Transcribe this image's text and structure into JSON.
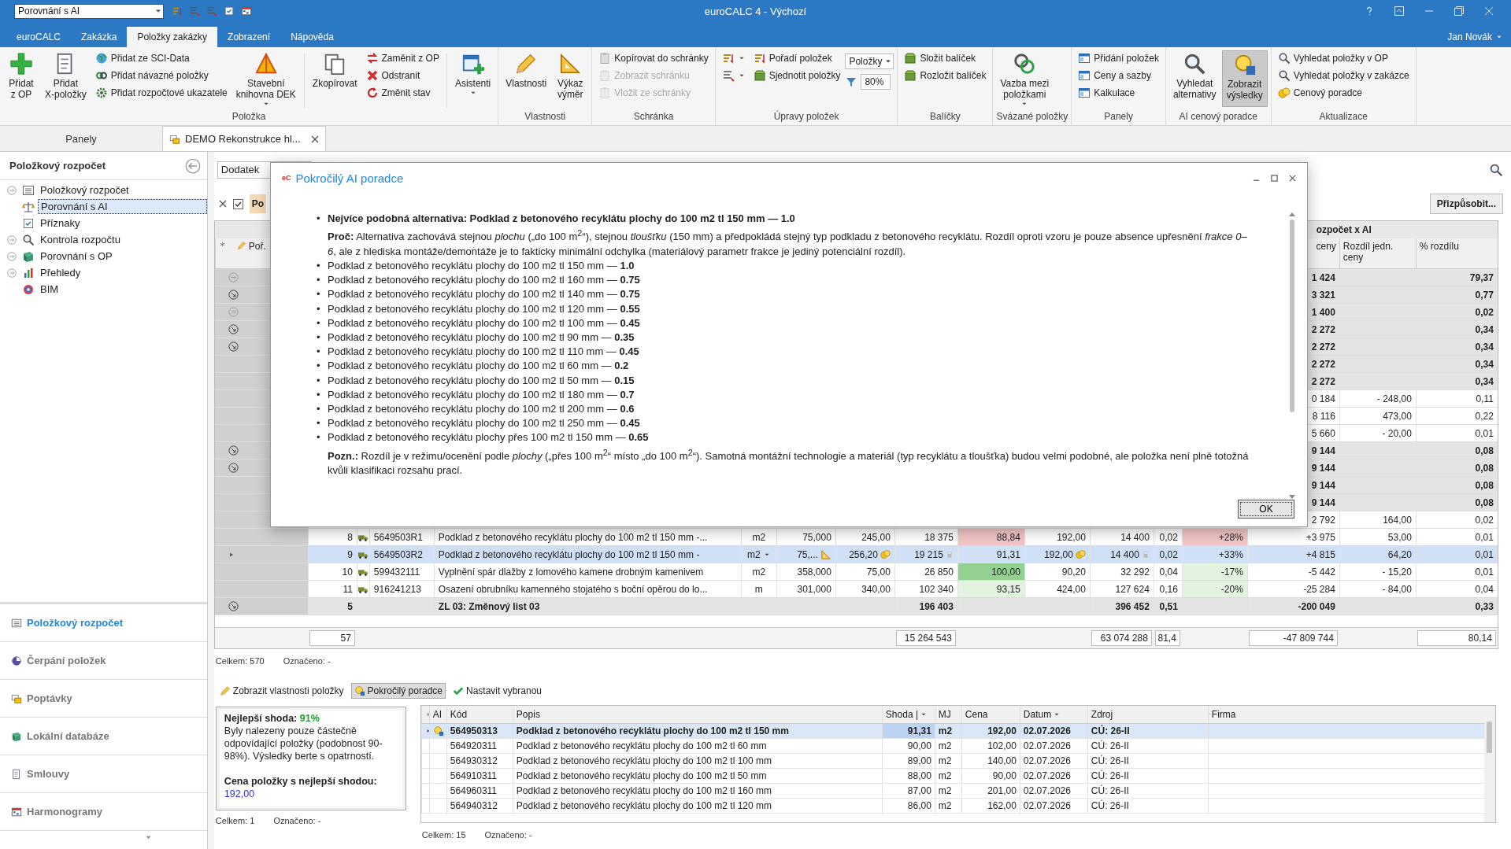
{
  "titlebar": {
    "quick_combo": "Porovnání s AI",
    "title": "euroCALC 4 - Výchozí"
  },
  "menu": {
    "tabs": [
      {
        "label": "euroCALC",
        "selected": false
      },
      {
        "label": "Zakázka",
        "selected": false
      },
      {
        "label": "Položky zakázky",
        "selected": true
      },
      {
        "label": "Zobrazení",
        "selected": false
      },
      {
        "label": "Nápověda",
        "selected": false
      }
    ],
    "user": "Jan Novák"
  },
  "ribbon": {
    "groups": [
      {
        "label": "Položka",
        "buttons": [
          {
            "kind": "large",
            "label": "Přidat\nz OP"
          },
          {
            "kind": "large",
            "label": "Přidat\nX-položky"
          },
          {
            "kind": "stack",
            "items": [
              {
                "label": "Přidat ze SCI-Data"
              },
              {
                "label": "Přidat návazné položky"
              },
              {
                "label": "Přidat rozpočtové ukazatele"
              }
            ]
          },
          {
            "kind": "large",
            "label": "Stavební\nknihovna DEK",
            "dropdown": true
          },
          {
            "kind": "separator"
          },
          {
            "kind": "large",
            "label": "Zkopírovat"
          },
          {
            "kind": "stack",
            "items": [
              {
                "label": "Zaměnit z OP"
              },
              {
                "label": "Odstranit"
              },
              {
                "label": "Změnit stav"
              }
            ]
          },
          {
            "kind": "separator"
          },
          {
            "kind": "large",
            "label": "Asistenti",
            "dropdown": true
          }
        ]
      },
      {
        "label": "Vlastnosti",
        "buttons": [
          {
            "kind": "large",
            "label": "Vlastnosti"
          },
          {
            "kind": "large",
            "label": "Výkaz\nvýměr"
          }
        ]
      },
      {
        "label": "Schránka",
        "buttons": [
          {
            "kind": "stack",
            "items": [
              {
                "label": "Kopírovat do schránky",
                "disabled": false
              },
              {
                "label": "Zobrazit schránku",
                "disabled": true
              },
              {
                "label": "Vložit ze schránky",
                "disabled": true
              }
            ]
          }
        ]
      },
      {
        "label": "Úpravy položek",
        "buttons": [
          {
            "kind": "icon-stack"
          },
          {
            "kind": "stack",
            "items": [
              {
                "label": "Pořadí položek"
              },
              {
                "label": "Sjednotit položky"
              }
            ]
          },
          {
            "kind": "editors",
            "combo": "Položky",
            "spin": "80%"
          }
        ]
      },
      {
        "label": "Balíčky",
        "buttons": [
          {
            "kind": "stack",
            "items": [
              {
                "label": "Složit balíček"
              },
              {
                "label": "Rozložit balíček"
              }
            ]
          }
        ]
      },
      {
        "label": "Svázané položky",
        "buttons": [
          {
            "kind": "large",
            "label": "Vazba mezi\npoložkami",
            "dropdown": true
          }
        ]
      },
      {
        "label": "Panely",
        "buttons": [
          {
            "kind": "stack",
            "items": [
              {
                "label": "Přidání položek"
              },
              {
                "label": "Ceny a sazby"
              },
              {
                "label": "Kalkulace"
              }
            ]
          }
        ]
      },
      {
        "label": "AI cenový poradce",
        "buttons": [
          {
            "kind": "large",
            "label": "Vyhledat\nalternativy",
            "pressed": false
          },
          {
            "kind": "large",
            "label": "Zobrazit\nvýsledky",
            "pressed": true
          }
        ]
      },
      {
        "label": "Aktualizace",
        "buttons": [
          {
            "kind": "stack",
            "items": [
              {
                "label": "Vyhledat položky v OP"
              },
              {
                "label": "Vyhledat položky v zakázce"
              },
              {
                "label": "Cenový poradce"
              }
            ]
          }
        ]
      }
    ]
  },
  "panels_header": "Panely",
  "document_tab": "DEMO Rekonstrukce hl...",
  "sidebar": {
    "title": "Položkový rozpočet",
    "tree": [
      {
        "label": "Položkový rozpočet",
        "kind": "branch",
        "selected": false
      },
      {
        "label": "Porovnání s AI",
        "kind": "leaf",
        "selected": true
      },
      {
        "label": "Příznaky",
        "kind": "leaf",
        "selected": false
      },
      {
        "label": "Kontrola rozpočtu",
        "kind": "branch",
        "selected": false
      },
      {
        "label": "Porovnání s OP",
        "kind": "branch",
        "selected": false
      },
      {
        "label": "Přehledy",
        "kind": "branch",
        "selected": false
      },
      {
        "label": "BIM",
        "kind": "leaf",
        "selected": false
      }
    ],
    "nav": [
      {
        "label": "Položkový rozpočet",
        "selected": true
      },
      {
        "label": "Čerpání položek",
        "selected": false
      },
      {
        "label": "Poptávky",
        "selected": false
      },
      {
        "label": "Lokální databáze",
        "selected": false
      },
      {
        "label": "Smlouvy",
        "selected": false
      },
      {
        "label": "Harmonogramy",
        "selected": false
      }
    ]
  },
  "toolbar": {
    "filter": "Dodatek",
    "show_all_checked": true,
    "tab_fragment": "Po",
    "customize_button": "Přizpůsobit..."
  },
  "table": {
    "group_header": "ozpočet x AI",
    "columns": {
      "por": "Poř.",
      "c6": "ceny",
      "c7": "Rozdíl jedn. ceny",
      "c8": "% rozdílu"
    },
    "rows": [
      {
        "kind": "group",
        "expanded": false,
        "selected": false,
        "c6": "1 424",
        "c8": "79,37"
      },
      {
        "kind": "group",
        "expanded": true,
        "selected": false,
        "c6": "3 321",
        "c8": "0,77"
      },
      {
        "kind": "group",
        "expanded": false,
        "selected": false,
        "c6": "1 400",
        "c8": "0,02"
      },
      {
        "kind": "group",
        "expanded": true,
        "selected": false,
        "c6": "2 272",
        "c8": "0,34"
      },
      {
        "kind": "group",
        "expanded": true,
        "selected": false,
        "c6": "2 272",
        "c8": "0,34"
      },
      {
        "kind": "group",
        "selected": false,
        "c6": "2 272",
        "c8": "0,34"
      },
      {
        "kind": "group",
        "selected": false,
        "c6": "2 272",
        "c8": "0,34"
      },
      {
        "kind": "item",
        "selected": false,
        "c6": "0 184",
        "c7": "- 248,00",
        "c8": "0,11"
      },
      {
        "kind": "item",
        "selected": false,
        "c6": "8 116",
        "c7": "473,00",
        "c8": "0,22"
      },
      {
        "kind": "item",
        "selected": false,
        "c6": "5 660",
        "c7": "- 20,00",
        "c8": "0,01"
      },
      {
        "kind": "group",
        "expanded": true,
        "selected": false,
        "c6": "9 144",
        "c8": "0,08"
      },
      {
        "kind": "group",
        "expanded": true,
        "selected": false,
        "c6": "9 144",
        "c8": "0,08"
      },
      {
        "kind": "group",
        "selected": false,
        "c6": "9 144",
        "c8": "0,08"
      },
      {
        "kind": "group",
        "selected": false,
        "c6": "9 144",
        "c8": "0,08"
      },
      {
        "kind": "item",
        "selected": false,
        "c6": "2 792",
        "c7": "164,00",
        "c8": "0,02"
      },
      {
        "kind": "item",
        "selected": false,
        "por": "8",
        "code": "5649503R1",
        "popis": "Podklad z betonového recyklátu plochy do 100 m2 tl 150 mm -...",
        "mj": "m2",
        "qty": "75,000",
        "price": "245,00",
        "total": "18 375",
        "c1": "88,84",
        "c2": "192,00",
        "c3": "14 400",
        "c4": "0,02",
        "c5": "+28%",
        "c6": "+3 975",
        "c7": "53,00",
        "c8": "0,01",
        "match": {
          "color": "#f3c6c6"
        },
        "diff": {
          "color": "#f3c6c6"
        }
      },
      {
        "kind": "item",
        "selected": true,
        "por": "9",
        "code": "5649503R2",
        "popis": "Podklad z betonového recyklátu plochy do 100 m2 tl 150 mm -",
        "mj": "m2",
        "qty": "75,...",
        "price": "256,20",
        "total": "19 215",
        "c1": "91,31",
        "c2": "192,00",
        "c3": "14 400",
        "c4": "0,02",
        "c5": "+33%",
        "c6": "+4 815",
        "c7": "64,20",
        "c8": "0,01"
      },
      {
        "kind": "item",
        "selected": false,
        "por": "10",
        "code": "599432111",
        "popis": "Vyplnění spár dlažby z lomového kamene drobným kamenivem",
        "mj": "m2",
        "qty": "358,000",
        "price": "75,00",
        "total": "26 850",
        "c1": "100,00",
        "c2": "90,20",
        "c3": "32 292",
        "c4": "0,04",
        "c5": "-17%",
        "c6": "-5 442",
        "c7": "- 15,20",
        "c8": "0,01",
        "match": {
          "color": "#92d190"
        },
        "diff": {
          "color": "#e2f3e0"
        }
      },
      {
        "kind": "item",
        "selected": false,
        "por": "11",
        "code": "916241213",
        "popis": "Osazení obrubníku kamenného stojatého s boční opěrou do lo...",
        "mj": "m",
        "qty": "301,000",
        "price": "340,00",
        "total": "102 340",
        "c1": "93,15",
        "c2": "424,00",
        "c3": "127 624",
        "c4": "0,16",
        "c5": "-20%",
        "c6": "-25 284",
        "c7": "- 84,00",
        "c8": "0,04",
        "match": {
          "color": "#e2f3e0"
        },
        "diff": {
          "color": "#e2f3e0"
        }
      },
      {
        "kind": "group",
        "expanded": true,
        "selected": false,
        "por": "5",
        "popis": "ZL 03: Změnový list 03",
        "total": "196 403",
        "c3": "396 452",
        "c4": "0,51",
        "c6": "-200 049",
        "c8": "0,33"
      }
    ],
    "footer": {
      "por": "57",
      "total": "15 264 543",
      "c3": "63 074 288",
      "c4": "81,4",
      "c6": "-47 809 744",
      "c8": "80,14"
    }
  },
  "status": {
    "total": "Celkem: 570",
    "marked": "Označeno: -"
  },
  "dialog": {
    "logo": "eC",
    "title": "Pokročilý AI poradce",
    "best": {
      "bullet": "•",
      "text": "Nejvíce podobná alternativa: Podklad z betonového recyklátu plochy do 100 m2 tl 150 mm — 1.0"
    },
    "reason": "**Proč:** Alternativa zachovává stejnou *plochu* („do 100 m$^{2}$“), stejnou *tloušťku* (150 mm) a předpokládá stejný typ podkladu z betonového recyklátu. Rozdíl oproti vzoru je pouze absence upřesnění *frakce 0–6*, ale z hlediska montáže/demontáže je to fakticky minimální odchylka (materiálový parametr frakce je jediný potenciální rozdíl).",
    "alternatives": [
      {
        "bullet": "•",
        "name": "Podklad z betonového recyklátu plochy do 100 m2 tl 150 mm —",
        "score": "1.0"
      },
      {
        "bullet": "•",
        "name": "Podklad z betonového recyklátu plochy do 100 m2 tl 160 mm —",
        "score": "0.75"
      },
      {
        "bullet": "•",
        "name": "Podklad z betonového recyklátu plochy do 100 m2 tl 140 mm —",
        "score": "0.75"
      },
      {
        "bullet": "•",
        "name": "Podklad z betonového recyklátu plochy do 100 m2 tl 120 mm —",
        "score": "0.55"
      },
      {
        "bullet": "•",
        "name": "Podklad z betonového recyklátu plochy do 100 m2 tl 100 mm —",
        "score": "0.45"
      },
      {
        "bullet": "•",
        "name": "Podklad z betonového recyklátu plochy do 100 m2 tl 90 mm —",
        "score": "0.35"
      },
      {
        "bullet": "•",
        "name": "Podklad z betonového recyklátu plochy do 100 m2 tl 110 mm —",
        "score": "0.45"
      },
      {
        "bullet": "•",
        "name": "Podklad z betonového recyklátu plochy do 100 m2 tl 60 mm —",
        "score": "0.2"
      },
      {
        "bullet": "•",
        "name": "Podklad z betonového recyklátu plochy do 100 m2 tl 50 mm —",
        "score": "0.15"
      },
      {
        "bullet": "•",
        "name": "Podklad z betonového recyklátu plochy do 100 m2 tl 180 mm —",
        "score": "0.7"
      },
      {
        "bullet": "•",
        "name": "Podklad z betonového recyklátu plochy do 100 m2 tl 200 mm —",
        "score": "0.6"
      },
      {
        "bullet": "•",
        "name": "Podklad z betonového recyklátu plochy do 100 m2 tl 250 mm —",
        "score": "0.45"
      },
      {
        "bullet": "•",
        "name": "Podklad z betonového recyklátu plochy přes 100 m2 tl 150 mm —",
        "score": "0.65"
      }
    ],
    "note": "**Pozn.:** Rozdíl je v režimu/ocenění podle *plochy* („přes 100 m$^{2}$“ místo „do 100 m$^{2}$“). Samotná montážní technologie a materiál (typ recyklátu a tloušťka) budou velmi podobné, ale položka není plně totožná kvůli klasifikaci rozsahu prací.",
    "ok": "OK"
  },
  "bottom_toolbar": [
    {
      "label": "Zobrazit vlastnosti položky",
      "pressed": false
    },
    {
      "label": "Pokročilý poradce",
      "pressed": true
    },
    {
      "label": "Nastavit vybranou",
      "pressed": false
    }
  ],
  "summary": {
    "best_label": "Nejlepší shoda:",
    "best_value": "91%",
    "text": "Byly nalezeny pouze částečně odpovídající položky (podobnost 90-98%). Výsledky berte s opatrností.",
    "price_label": "Cena položky s nejlepší shodou:",
    "price_value": "192,00"
  },
  "summary_status": {
    "total": "Celkem: 1",
    "marked": "Označeno: -"
  },
  "results": {
    "columns": [
      "AI",
      "Kód",
      "Popis",
      "Shoda |",
      "MJ",
      "Cena",
      "Datum",
      "Zdroj",
      "Firma"
    ],
    "rows": [
      {
        "ai": true,
        "selected": true,
        "code": "564950313",
        "popis": "Podklad z betonového recyklátu plochy do 100 m2 tl 150 mm",
        "shoda": "91,31",
        "mj": "m2",
        "cena": "192,00",
        "datum": "02.07.2026",
        "zdroj": "CÚ: 26-II"
      },
      {
        "ai": false,
        "selected": false,
        "code": "564920311",
        "popis": "Podklad z betonového recyklátu plochy do 100 m2 tl 60 mm",
        "shoda": "90,00",
        "mj": "m2",
        "cena": "102,00",
        "datum": "02.07.2026",
        "zdroj": "CÚ: 26-II"
      },
      {
        "ai": false,
        "selected": false,
        "code": "564930312",
        "popis": "Podklad z betonového recyklátu plochy do 100 m2 tl 100 mm",
        "shoda": "89,00",
        "mj": "m2",
        "cena": "140,00",
        "datum": "02.07.2026",
        "zdroj": "CÚ: 26-II"
      },
      {
        "ai": false,
        "selected": false,
        "code": "564910311",
        "popis": "Podklad z betonového recyklátu plochy do 100 m2 tl 50 mm",
        "shoda": "88,00",
        "mj": "m2",
        "cena": "90,00",
        "datum": "02.07.2026",
        "zdroj": "CÚ: 26-II"
      },
      {
        "ai": false,
        "selected": false,
        "code": "564960311",
        "popis": "Podklad z betonového recyklátu plochy do 100 m2 tl 160 mm",
        "shoda": "87,00",
        "mj": "m2",
        "cena": "201,00",
        "datum": "02.07.2026",
        "zdroj": "CÚ: 26-II"
      },
      {
        "ai": false,
        "selected": false,
        "code": "564940312",
        "popis": "Podklad z betonového recyklátu plochy do 100 m2 tl 120 mm",
        "shoda": "86,00",
        "mj": "m2",
        "cena": "162,00",
        "datum": "02.07.2026",
        "zdroj": "CÚ: 26-II"
      }
    ]
  },
  "results_status": {
    "total": "Celkem: 15",
    "marked": "Označeno: -"
  }
}
